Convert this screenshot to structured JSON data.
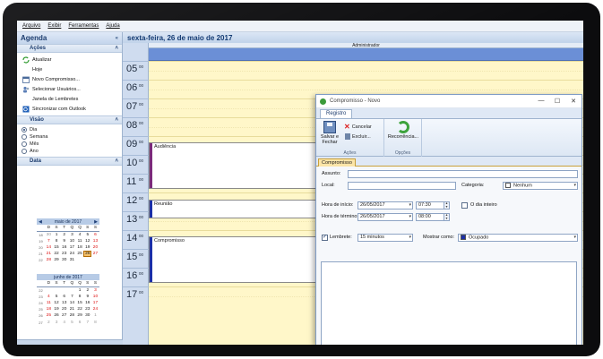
{
  "menu": [
    "Arquivo",
    "Exibir",
    "Ferramentas",
    "Ajuda"
  ],
  "nav": {
    "title": "Agenda",
    "collapse_glyph": "«",
    "actions_title": "Ações",
    "actions": [
      {
        "label": "Atualizar",
        "icon": "refresh-icon"
      },
      {
        "label": "Hoje",
        "icon": ""
      },
      {
        "label": "Novo Compromisso...",
        "icon": "new-appointment-icon"
      },
      {
        "label": "Selecionar Usuários...",
        "icon": "users-icon"
      },
      {
        "label": "Janela de Lembretes",
        "icon": ""
      },
      {
        "label": "Sincronizar com Outlook",
        "icon": "outlook-icon"
      }
    ],
    "view_title": "Visão",
    "views": [
      {
        "label": "Dia",
        "selected": true
      },
      {
        "label": "Semana",
        "selected": false
      },
      {
        "label": "Mês",
        "selected": false
      },
      {
        "label": "Ano",
        "selected": false
      }
    ],
    "date_title": "Data",
    "section_glyph": "˄"
  },
  "calendars": [
    {
      "title": "maio de 2017",
      "prev": "◀",
      "next": "▶",
      "dow": [
        "D",
        "S",
        "T",
        "Q",
        "Q",
        "S",
        "S"
      ],
      "weeks": [
        {
          "wk": "18",
          "days": [
            "30",
            "1",
            "2",
            "3",
            "4",
            "5",
            "6"
          ]
        },
        {
          "wk": "19",
          "days": [
            "7",
            "8",
            "9",
            "10",
            "11",
            "12",
            "13"
          ]
        },
        {
          "wk": "20",
          "days": [
            "14",
            "15",
            "16",
            "17",
            "18",
            "19",
            "20"
          ]
        },
        {
          "wk": "21",
          "days": [
            "21",
            "22",
            "23",
            "24",
            "25",
            "26",
            "27"
          ]
        },
        {
          "wk": "22",
          "days": [
            "28",
            "29",
            "30",
            "31",
            "",
            "",
            ""
          ]
        }
      ]
    },
    {
      "title": "junho de 2017",
      "prev": "",
      "next": "",
      "dow": [
        "D",
        "S",
        "T",
        "Q",
        "Q",
        "S",
        "S"
      ],
      "weeks": [
        {
          "wk": "22",
          "days": [
            "",
            "",
            "",
            "",
            "1",
            "2",
            "3"
          ]
        },
        {
          "wk": "23",
          "days": [
            "4",
            "5",
            "6",
            "7",
            "8",
            "9",
            "10"
          ]
        },
        {
          "wk": "24",
          "days": [
            "11",
            "12",
            "13",
            "14",
            "15",
            "16",
            "17"
          ]
        },
        {
          "wk": "25",
          "days": [
            "18",
            "19",
            "20",
            "21",
            "22",
            "23",
            "24"
          ]
        },
        {
          "wk": "26",
          "days": [
            "25",
            "26",
            "27",
            "28",
            "29",
            "30",
            "1"
          ]
        },
        {
          "wk": "27",
          "days": [
            "2",
            "3",
            "4",
            "5",
            "6",
            "7",
            "8"
          ]
        }
      ]
    }
  ],
  "today": "26",
  "main": {
    "date": "sexta-feira, 26 de maio de 2017",
    "resource": "Administrador",
    "hours": [
      {
        "h": "05",
        "m": "00"
      },
      {
        "h": "06",
        "m": "00"
      },
      {
        "h": "07",
        "m": "00"
      },
      {
        "h": "08",
        "m": "00"
      },
      {
        "h": "09",
        "m": "00"
      },
      {
        "h": "10",
        "m": "00"
      },
      {
        "h": "11",
        "m": "00"
      },
      {
        "h": "12",
        "m": "00"
      },
      {
        "h": "13",
        "m": "00"
      },
      {
        "h": "14",
        "m": "00"
      },
      {
        "h": "15",
        "m": "00"
      },
      {
        "h": "16",
        "m": "00"
      },
      {
        "h": "17",
        "m": "00"
      }
    ],
    "appointments": [
      {
        "title": "Audiência",
        "color": "#7b2a7b"
      },
      {
        "title": "Reunião",
        "color": "#1b2fa8"
      },
      {
        "title": "Compromisso",
        "color": "#1b2fa8"
      }
    ]
  },
  "dialog": {
    "title": "Compromisso - Novo",
    "window_buttons": [
      "—",
      "☐",
      "✕"
    ],
    "tab": "Registro",
    "ribbon": {
      "save": "Salvar e Fechar",
      "cancel": "Cancelar",
      "delete": "Excluir...",
      "actions_group": "Ações",
      "recurrence": "Recorrência...",
      "options_group": "Opções"
    },
    "subtab": "Compromisso",
    "form": {
      "subject_label": "Assunto:",
      "subject_value": "",
      "location_label": "Local:",
      "location_value": "",
      "category_label": "Categoria:",
      "category_value": "Nenhum",
      "start_label": "Hora de início:",
      "start_date": "26/05/2017",
      "start_time": "07:30",
      "end_label": "Hora de término:",
      "end_date": "26/05/2017",
      "end_time": "08:00",
      "allday_label": "O dia inteiro",
      "allday_checked": false,
      "reminder_label": "Lembrete:",
      "reminder_checked": true,
      "reminder_value": "15 minutos",
      "showas_label": "Mostrar como:",
      "showas_value": "Ocupado",
      "showas_color": "#1b2fa8",
      "dropdown_glyph": "▾",
      "spin_up": "▲",
      "spin_down": "▼",
      "check_glyph": "✓"
    }
  }
}
